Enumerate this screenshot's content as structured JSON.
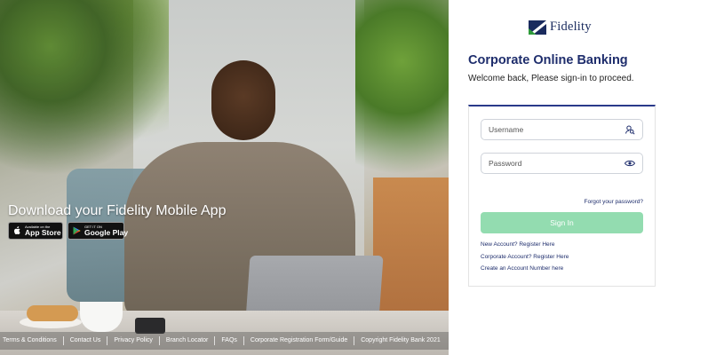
{
  "hero": {
    "download_title": "Download your Fidelity Mobile App",
    "app_store": {
      "small": "Available on the",
      "big": "App Store"
    },
    "google_play": {
      "small": "GET IT ON",
      "big": "Google Play"
    }
  },
  "footer": {
    "links": [
      "Terms & Conditions",
      "Contact Us",
      "Privacy Policy",
      "Branch Locator",
      "FAQs",
      "Corporate Registration Form/Guide",
      "Copyright Fidelity Bank 2021"
    ]
  },
  "brand": {
    "name": "Fidelity",
    "colors": {
      "navy": "#1e2d6c",
      "green": "#2e9b3a",
      "button": "#93dcb0"
    }
  },
  "login": {
    "title": "Corporate Online Banking",
    "subtitle": "Welcome back, Please sign-in to proceed.",
    "username_placeholder": "Username",
    "password_placeholder": "Password",
    "forgot": "Forgot your password?",
    "signin": "Sign In",
    "links": {
      "new_account": "New Account? Register Here",
      "corporate_account": "Corporate Account? Register Here",
      "create_number": "Create an Account Number here"
    }
  }
}
